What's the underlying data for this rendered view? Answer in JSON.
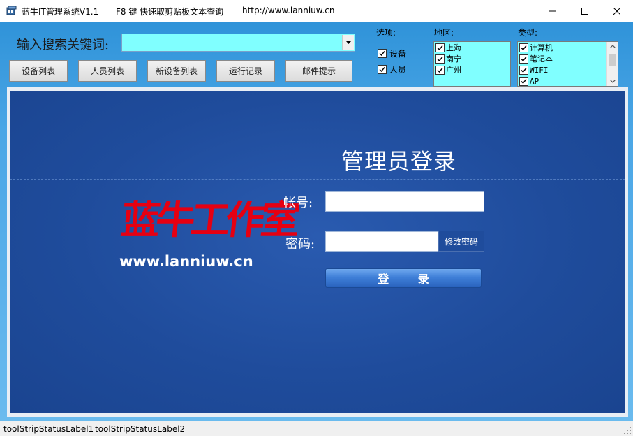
{
  "window": {
    "title": "蓝牛IT管理系统V1.1",
    "hint": "F8 键 快速取剪贴板文本查询",
    "url": "http://www.lanniuw.cn",
    "minimize_icon": "minimize-icon",
    "maximize_icon": "maximize-icon",
    "close_icon": "close-icon"
  },
  "search": {
    "label": "输入搜索关键词:",
    "value": "",
    "background": "#80ffff"
  },
  "toolbar": {
    "buttons": [
      "设备列表",
      "人员列表",
      "新设备列表",
      "运行记录",
      "邮件提示"
    ]
  },
  "options": {
    "label": "选项:",
    "items": [
      {
        "label": "设备",
        "checked": true
      },
      {
        "label": "人员",
        "checked": true
      }
    ]
  },
  "region": {
    "label": "地区:",
    "items": [
      {
        "label": "上海",
        "checked": true
      },
      {
        "label": "南宁",
        "checked": true
      },
      {
        "label": "广州",
        "checked": true
      }
    ]
  },
  "types": {
    "label": "类型:",
    "items": [
      {
        "label": "计算机",
        "checked": true
      },
      {
        "label": "笔记本",
        "checked": true
      },
      {
        "label": "WIFI",
        "checked": true
      },
      {
        "label": "AP",
        "checked": true
      }
    ]
  },
  "login": {
    "title": "管理员登录",
    "account_label": "帐号:",
    "password_label": "密码:",
    "change_password": "修改密码",
    "submit": "登 录",
    "logo_text": "蓝牛工作室",
    "logo_url": "www.lanniuw.cn",
    "logo_color": "#e60012",
    "panel_color": "#1f4c9c"
  },
  "status": {
    "label1": "toolStripStatusLabel1",
    "label2": "toolStripStatusLabel2"
  }
}
